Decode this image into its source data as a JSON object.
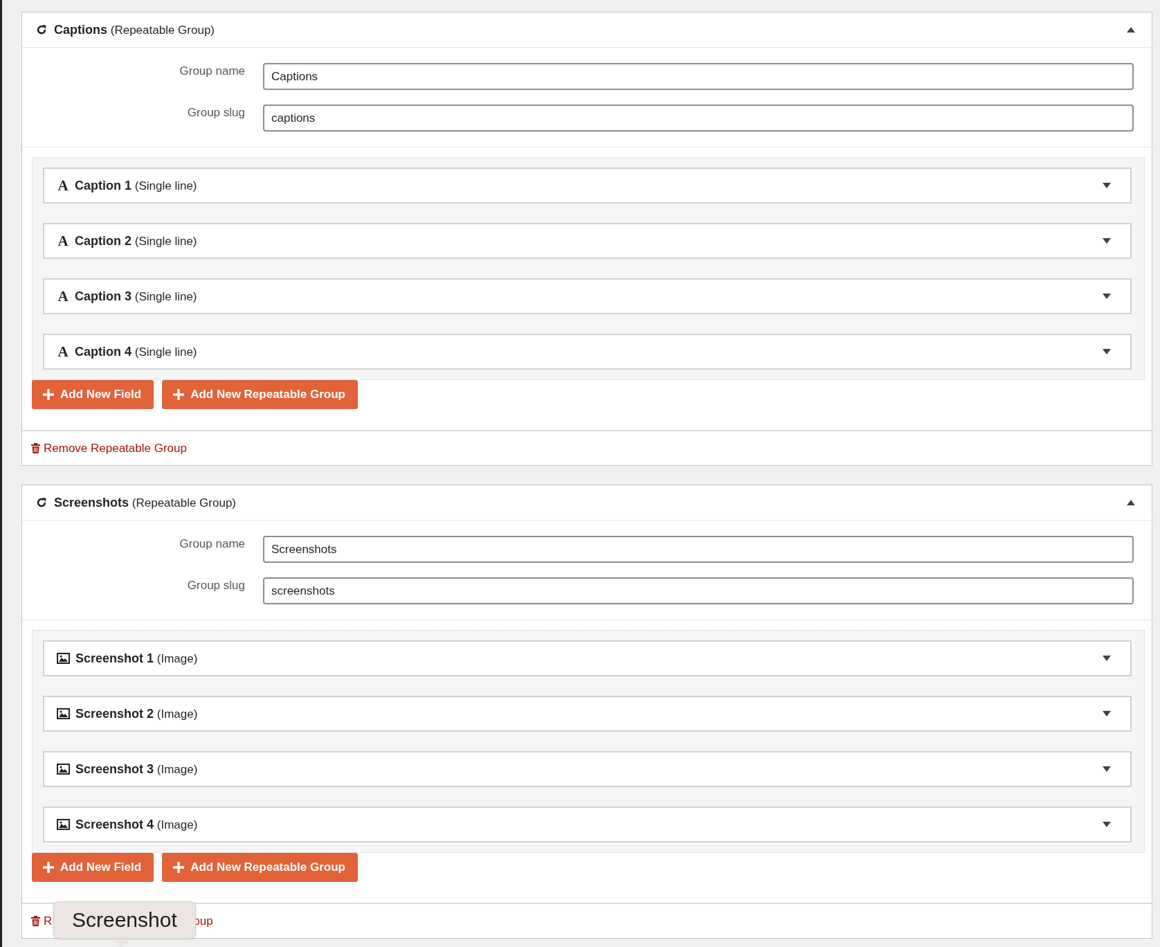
{
  "groups": [
    {
      "name": "Captions",
      "type_label": "(Repeatable Group)",
      "expanded": true,
      "settings": [
        {
          "label": "Group name",
          "value": "Captions"
        },
        {
          "label": "Group slug",
          "value": "captions"
        }
      ],
      "fields": [
        {
          "kind": "text",
          "icon": "A",
          "name": "Caption 1",
          "type_label": "(Single line)",
          "expanded": false
        },
        {
          "kind": "text",
          "icon": "A",
          "name": "Caption 2",
          "type_label": "(Single line)",
          "expanded": false
        },
        {
          "kind": "text",
          "icon": "A",
          "name": "Caption 3",
          "type_label": "(Single line)",
          "expanded": false
        },
        {
          "kind": "text",
          "icon": "A",
          "name": "Caption 4",
          "type_label": "(Single line)",
          "expanded": false
        }
      ],
      "buttons": [
        "Add New Field",
        "Add New Repeatable Group"
      ],
      "remove_link_parts": [
        "Remove Repeatable Group"
      ]
    },
    {
      "name": "Screenshots",
      "type_label": "(Repeatable Group)",
      "expanded": true,
      "settings": [
        {
          "label": "Group name",
          "value": "Screenshots"
        },
        {
          "label": "Group slug",
          "value": "screenshots"
        }
      ],
      "fields": [
        {
          "kind": "image",
          "name": "Screenshot 1",
          "type_label": "(Image)",
          "expanded": false
        },
        {
          "kind": "image",
          "name": "Screenshot 2",
          "type_label": "(Image)",
          "expanded": false
        },
        {
          "kind": "image",
          "name": "Screenshot 3",
          "type_label": "(Image)",
          "expanded": false
        },
        {
          "kind": "image",
          "name": "Screenshot 4",
          "type_label": "(Image)",
          "expanded": false
        }
      ],
      "buttons": [
        "Add New Field",
        "Add New Repeatable Group"
      ],
      "remove_link_parts": [
        "R",
        "oup"
      ],
      "tooltip": "Screenshot"
    }
  ]
}
